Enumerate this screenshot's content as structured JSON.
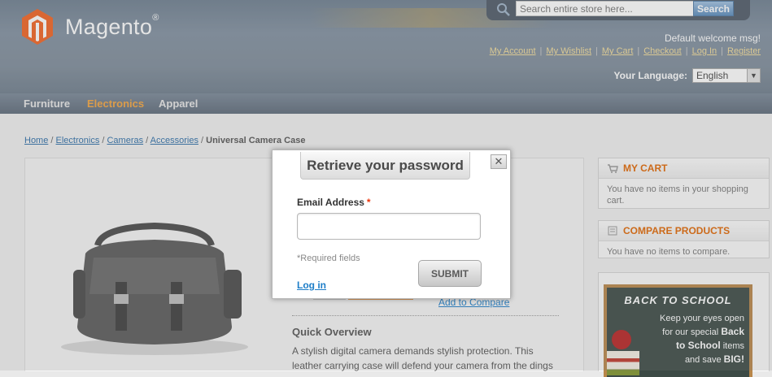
{
  "colors": {
    "header_bg": "#7d8c9b",
    "nav_active": "#f4a53f",
    "link": "#1e7ec8",
    "box_title": "#e26703",
    "required_star": "#eb340a"
  },
  "header": {
    "logo_text": "Magento",
    "logo_mark": "®",
    "search": {
      "placeholder": "Search entire store here...",
      "button_label": "Search",
      "icon": "search-icon"
    },
    "welcome": "Default welcome msg!",
    "links": [
      "My Account",
      "My Wishlist",
      "My Cart",
      "Checkout",
      "Log In",
      "Register"
    ],
    "language": {
      "label": "Your Language:",
      "selected": "English"
    }
  },
  "nav": {
    "items": [
      "Furniture",
      "Electronics",
      "Apparel"
    ],
    "active": "Electronics"
  },
  "breadcrumbs": {
    "links": [
      "Home",
      "Electronics",
      "Cameras",
      "Accessories"
    ],
    "separator": " / ",
    "current": "Universal Camera Case"
  },
  "product": {
    "add_to_compare": "Add to Compare",
    "quick_overview_title": "Quick Overview",
    "quick_overview_text": "A stylish digital camera demands stylish protection. This leather carrying case will defend your camera from the dings"
  },
  "sidebar": {
    "cart": {
      "title": "MY CART",
      "text": "You have no items in your shopping cart."
    },
    "compare": {
      "title": "COMPARE PRODUCTS",
      "text": "You have no items to compare."
    },
    "promo": {
      "title": "BACK TO SCHOOL",
      "line1": "Keep your eyes open",
      "line2": "for our special",
      "bold1": "Back",
      "bold2": "to School",
      "line3": "items",
      "line4": "and save",
      "bold3": "BIG!"
    }
  },
  "modal": {
    "title": "Retrieve your password",
    "close_label": "✕",
    "email_label": "Email Address",
    "required_star": "*",
    "required_fields": "*Required fields",
    "submit_label": "SUBMIT",
    "login_link": "Log in"
  }
}
